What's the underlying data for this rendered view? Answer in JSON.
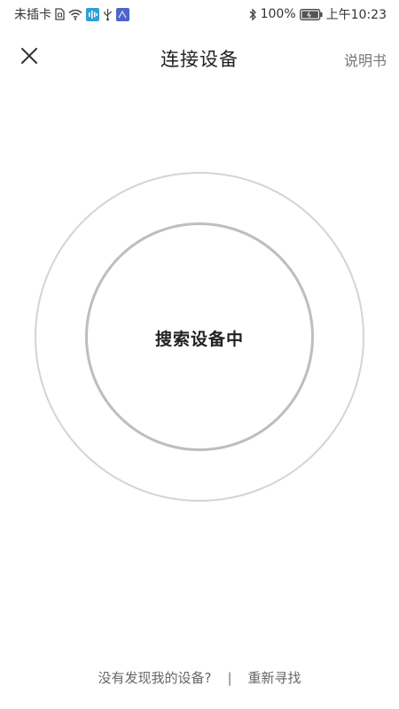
{
  "status_bar": {
    "carrier": "未插卡",
    "battery": "100%",
    "time": "上午10:23",
    "icons": [
      "sim-icon",
      "wifi-icon",
      "audio-app-icon",
      "usb-icon",
      "app-icon",
      "bluetooth-icon",
      "battery-icon"
    ]
  },
  "header": {
    "title": "连接设备",
    "manual_label": "说明书",
    "close_icon": "close-icon"
  },
  "main": {
    "status_text": "搜索设备中"
  },
  "footer": {
    "not_found_text": "没有发现我的设备?",
    "separator": "|",
    "rescan_label": "重新寻找"
  },
  "colors": {
    "outer_ring": "#d4d4d6",
    "inner_ring": "#bdbdc2",
    "text_primary": "#222222",
    "text_secondary": "#777777"
  }
}
